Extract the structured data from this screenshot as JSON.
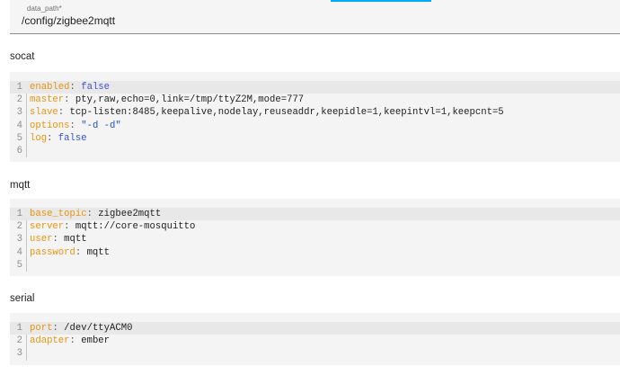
{
  "field": {
    "label": "data_path*",
    "value": "/config/zigbee2mqtt"
  },
  "sections": [
    {
      "title": "socat",
      "lines": [
        [
          {
            "t": "enabled",
            "c": "k"
          },
          {
            "t": ": ",
            "c": "p"
          },
          {
            "t": "false",
            "c": "bool"
          }
        ],
        [
          {
            "t": "master",
            "c": "k"
          },
          {
            "t": ": ",
            "c": "p"
          },
          {
            "t": "pty,raw,echo=0,link=/tmp/ttyZ2M,mode=777",
            "c": "v"
          }
        ],
        [
          {
            "t": "slave",
            "c": "k"
          },
          {
            "t": ": ",
            "c": "p"
          },
          {
            "t": "tcp-listen:8485,keepalive,nodelay,reuseaddr,keepidle=1,keepintvl=1,keepcnt=5",
            "c": "v"
          }
        ],
        [
          {
            "t": "options",
            "c": "k"
          },
          {
            "t": ": ",
            "c": "p"
          },
          {
            "t": "\"-d -d\"",
            "c": "str"
          }
        ],
        [
          {
            "t": "log",
            "c": "k"
          },
          {
            "t": ": ",
            "c": "p"
          },
          {
            "t": "false",
            "c": "bool"
          }
        ],
        []
      ]
    },
    {
      "title": "mqtt",
      "lines": [
        [
          {
            "t": "base_topic",
            "c": "k"
          },
          {
            "t": ": ",
            "c": "p"
          },
          {
            "t": "zigbee2mqtt",
            "c": "v"
          }
        ],
        [
          {
            "t": "server",
            "c": "k"
          },
          {
            "t": ": ",
            "c": "p"
          },
          {
            "t": "mqtt://core-mosquitto",
            "c": "v"
          }
        ],
        [
          {
            "t": "user",
            "c": "k"
          },
          {
            "t": ": ",
            "c": "p"
          },
          {
            "t": "mqtt",
            "c": "v"
          }
        ],
        [
          {
            "t": "password",
            "c": "k"
          },
          {
            "t": ": ",
            "c": "p"
          },
          {
            "t": "mqtt",
            "c": "v"
          }
        ],
        []
      ]
    },
    {
      "title": "serial",
      "lines": [
        [
          {
            "t": "port",
            "c": "k"
          },
          {
            "t": ": ",
            "c": "p"
          },
          {
            "t": "/dev/ttyACM0",
            "c": "v"
          }
        ],
        [
          {
            "t": "adapter",
            "c": "k"
          },
          {
            "t": ": ",
            "c": "p"
          },
          {
            "t": "ember",
            "c": "v"
          }
        ],
        []
      ]
    }
  ]
}
